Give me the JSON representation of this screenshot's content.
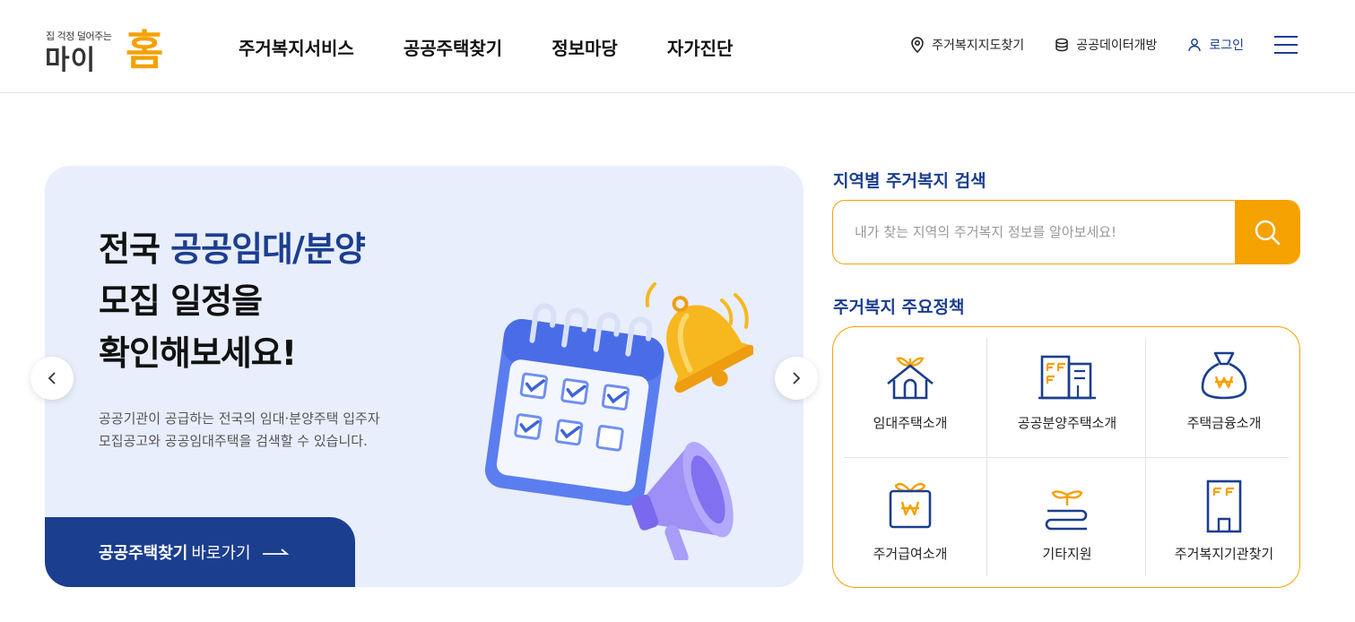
{
  "logo": {
    "tagline": "집 걱정 덜어주는",
    "main": "마이",
    "accent": "홈"
  },
  "gnb": [
    "주거복지서비스",
    "공공주택찾기",
    "정보마당",
    "자가진단"
  ],
  "util": {
    "map": "주거복지지도찾기",
    "data": "공공데이터개방",
    "login": "로그인"
  },
  "banner": {
    "line1_a": "전국 ",
    "line1_b": "공공임대/분양",
    "line2": "모집 일정을",
    "line3": "확인해보세요!",
    "desc": "공공기관이 공급하는 전국의 임대·분양주택 입주자 모집공고와 공공임대주택을 검색할 수 있습니다.",
    "cta_bold": "공공주택찾기",
    "cta_rest": "바로가기"
  },
  "search": {
    "title": "지역별 주거복지 검색",
    "placeholder": "내가 찾는 지역의 주거복지 정보를 알아보세요!"
  },
  "policy": {
    "title": "주거복지 주요정책",
    "items": [
      {
        "label": "임대주택소개",
        "icon": "house-sprout-icon"
      },
      {
        "label": "공공분양주택소개",
        "icon": "buildings-icon"
      },
      {
        "label": "주택금융소개",
        "icon": "money-bag-icon"
      },
      {
        "label": "주거급여소개",
        "icon": "gift-won-icon"
      },
      {
        "label": "기타지원",
        "icon": "sprout-hand-icon"
      },
      {
        "label": "주거복지기관찾기",
        "icon": "office-building-icon"
      }
    ]
  },
  "colors": {
    "brand_blue": "#1b3e8f",
    "accent_orange": "#f5a100",
    "banner_bg": "#e8eefc"
  }
}
